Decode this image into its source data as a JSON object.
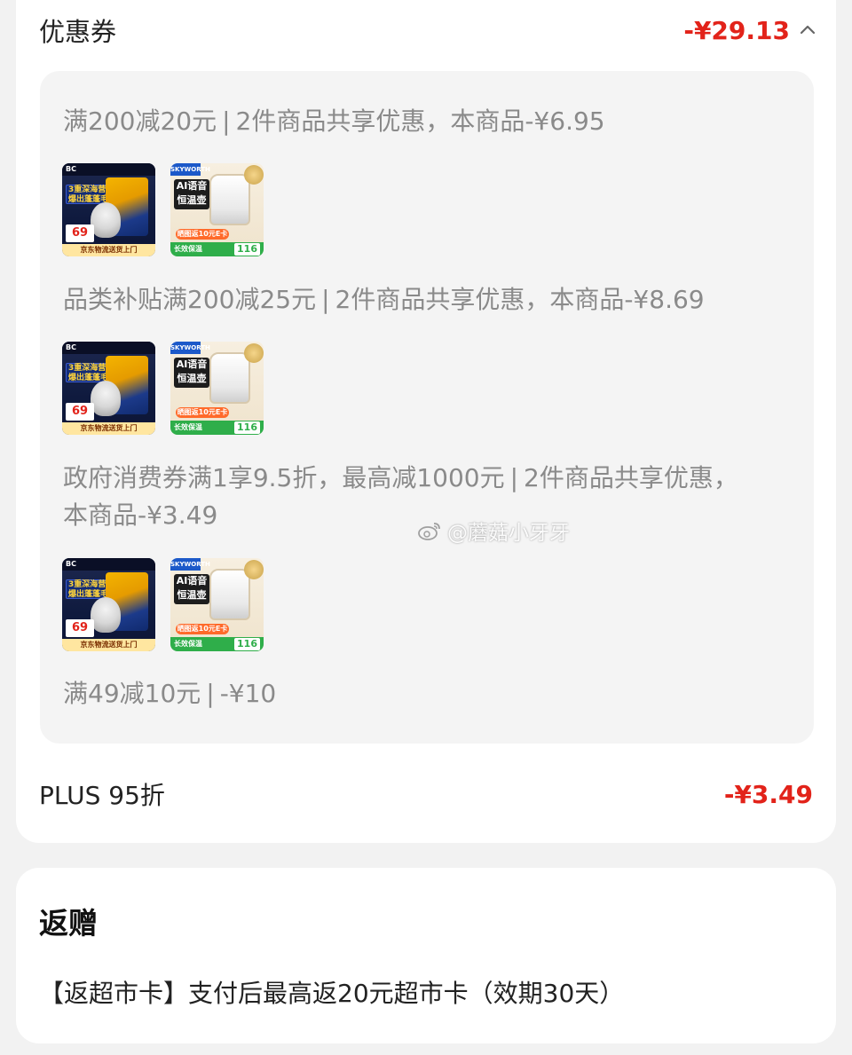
{
  "coupon": {
    "title": "优惠券",
    "total": "-¥29.13"
  },
  "promos": [
    {
      "name": "满200减20元",
      "detail": "2件商品共享优惠，本商品-¥6.95"
    },
    {
      "name": "品类补贴满200减25元",
      "detail": "2件商品共享优惠，本商品-¥8.69"
    },
    {
      "name": "政府消费券满1享9.5折，最高减1000元",
      "detail": "2件商品共享优惠，",
      "detail2": "本商品-¥3.49"
    },
    {
      "name": "满49减10元",
      "detail": "-¥10"
    }
  ],
  "separator": "|",
  "thumbs": {
    "cat": {
      "brand": "BC",
      "headline_1": "3重深海营养",
      "headline_2": "爆出蓬蓬毛",
      "price": "69",
      "footer": "京东物流送货上门"
    },
    "kettle": {
      "brand": "SKYWORTH",
      "ai_line_1": "AI语音",
      "ai_line_2": "恒温壶",
      "gift": "晒图返10元E卡",
      "footer": "长效保温",
      "price": "116"
    }
  },
  "plus": {
    "label": "PLUS 95折",
    "value": "-¥3.49"
  },
  "gift_section": {
    "title": "返赠",
    "text": "【返超市卡】支付后最高返20元超市卡（效期30天）"
  },
  "watermark": "@蘑菇小牙牙",
  "colors": {
    "price_red": "#e2231a",
    "promo_gray": "#8a8a8a",
    "panel_bg": "#f4f4f4"
  }
}
